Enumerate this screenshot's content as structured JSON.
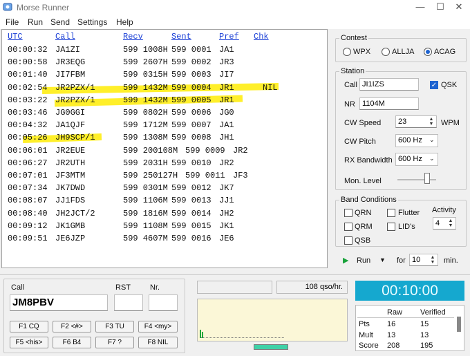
{
  "window": {
    "title": "Morse Runner"
  },
  "menu": [
    "File",
    "Run",
    "Send",
    "Settings",
    "Help"
  ],
  "log": {
    "headers": [
      "UTC",
      "Call",
      "Recv",
      "Sent",
      "Pref",
      "Chk"
    ],
    "rows": [
      {
        "utc": "00:00:32",
        "call": "JA1ZI",
        "recv": "599 1008H",
        "sent": "599 0001",
        "pref": "JA1",
        "chk": ""
      },
      {
        "utc": "00:00:58",
        "call": "JR3EQG",
        "recv": "599 2607H",
        "sent": "599 0002",
        "pref": "JR3",
        "chk": ""
      },
      {
        "utc": "00:01:40",
        "call": "JI7FBM",
        "recv": "599 0315H",
        "sent": "599 0003",
        "pref": "JI7",
        "chk": ""
      },
      {
        "utc": "00:02:54",
        "call": "JR2PZX/1",
        "recv": "599 1432M",
        "sent": "599 0004",
        "pref": "JR1",
        "chk": "NIL"
      },
      {
        "utc": "00:03:22",
        "call": "JR2PZX/1",
        "recv": "599 1432M",
        "sent": "599 0005",
        "pref": "JR1",
        "chk": ""
      },
      {
        "utc": "00:03:46",
        "call": "JG0GGI",
        "recv": "599 0802H",
        "sent": "599 0006",
        "pref": "JG0",
        "chk": ""
      },
      {
        "utc": "00:04:32",
        "call": "JA1QJF",
        "recv": "599 1712M",
        "sent": "599 0007",
        "pref": "JA1",
        "chk": ""
      },
      {
        "utc": "00:05:26",
        "call": "JH9SCP/1",
        "recv": "599 1308M",
        "sent": "599 0008",
        "pref": "JH1",
        "chk": ""
      },
      {
        "utc": "00:06:01",
        "call": "JR2EUE",
        "recv": "599 200108M",
        "sent": "599 0009",
        "pref": "JR2",
        "chk": ""
      },
      {
        "utc": "00:06:27",
        "call": "JR2UTH",
        "recv": "599 2031H",
        "sent": "599 0010",
        "pref": "JR2",
        "chk": ""
      },
      {
        "utc": "00:07:01",
        "call": "JF3MTM",
        "recv": "599 250127H",
        "sent": "599 0011",
        "pref": "JF3",
        "chk": ""
      },
      {
        "utc": "00:07:34",
        "call": "JK7DWD",
        "recv": "599 0301M",
        "sent": "599 0012",
        "pref": "JK7",
        "chk": ""
      },
      {
        "utc": "00:08:07",
        "call": "JJ1FDS",
        "recv": "599 1106M",
        "sent": "599 0013",
        "pref": "JJ1",
        "chk": ""
      },
      {
        "utc": "00:08:40",
        "call": "JH2JCT/2",
        "recv": "599 1816M",
        "sent": "599 0014",
        "pref": "JH2",
        "chk": ""
      },
      {
        "utc": "00:09:12",
        "call": "JK1GMB",
        "recv": "599 1108M",
        "sent": "599 0015",
        "pref": "JK1",
        "chk": ""
      },
      {
        "utc": "00:09:51",
        "call": "JE6JZP",
        "recv": "599 4607M",
        "sent": "599 0016",
        "pref": "JE6",
        "chk": ""
      }
    ]
  },
  "contest": {
    "label": "Contest",
    "options": [
      "WPX",
      "ALLJA",
      "ACAG"
    ],
    "selected": "ACAG"
  },
  "station": {
    "label": "Station",
    "call_label": "Call",
    "call_value": "JI1IZS",
    "qsk_label": "QSK",
    "qsk_checked": true,
    "nr_label": "NR",
    "nr_value": "1104M",
    "cw_speed_label": "CW Speed",
    "cw_speed_value": "23",
    "cw_speed_unit": "WPM",
    "cw_pitch_label": "CW Pitch",
    "cw_pitch_value": "600 Hz",
    "rx_bw_label": "RX Bandwidth",
    "rx_bw_value": "600 Hz",
    "mon_level_label": "Mon. Level"
  },
  "band": {
    "label": "Band Conditions",
    "qrn": "QRN",
    "flutter": "Flutter",
    "qrm": "QRM",
    "lids": "LID's",
    "qsb": "QSB",
    "activity_label": "Activity",
    "activity_value": "4"
  },
  "run": {
    "label": "Run",
    "for_label": "for",
    "minutes": "10",
    "min_label": "min."
  },
  "entry": {
    "call_label": "Call",
    "call_value": "JM8PBV",
    "rst_label": "RST",
    "rst_value": "",
    "nr_label": "Nr.",
    "nr_value": ""
  },
  "fkeys": [
    "F1 CQ",
    "F2 <#>",
    "F3 TU",
    "F4 <my>",
    "F5 <his>",
    "F6 B4",
    "F7 ?",
    "F8 NIL"
  ],
  "rate": "108 qso/hr.",
  "clock": "00:10:00",
  "score": {
    "col_raw": "Raw",
    "col_verified": "Verified",
    "rows": [
      {
        "label": "Pts",
        "raw": "16",
        "verified": "15"
      },
      {
        "label": "Mult",
        "raw": "13",
        "verified": "13"
      },
      {
        "label": "Score",
        "raw": "208",
        "verified": "195"
      }
    ]
  },
  "colors": {
    "accent": "#1e63d0",
    "highlight": "#ffef2a",
    "clock_bg": "#15a8cf",
    "scope_bg": "#fbf7d7"
  }
}
